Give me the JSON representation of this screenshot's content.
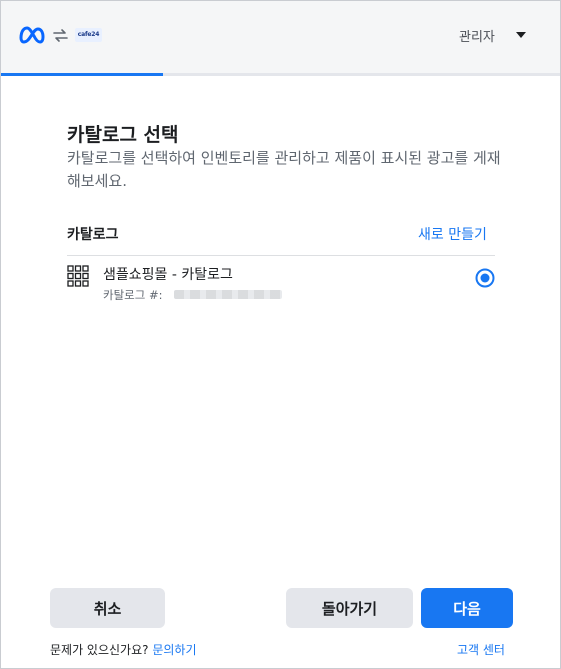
{
  "header": {
    "partner_logo_text": "cafe24",
    "admin_label": "관리자"
  },
  "progress": {
    "fraction": 0.29
  },
  "dialog": {
    "title": "카탈로그 선택",
    "subtitle": "카탈로그를 선택하여 인벤토리를 관리하고 제품이 표시된 광고를 게재해보세요."
  },
  "catalog_section": {
    "label": "카탈로그",
    "create_new": "새로 만들기",
    "items": [
      {
        "name": "샘플쇼핑몰 - 카탈로그",
        "id_label": "카탈로그 #:",
        "selected": true
      }
    ]
  },
  "footer": {
    "cancel": "취소",
    "back": "돌아가기",
    "next": "다음",
    "help_question": "문제가 있으신가요?",
    "help_link": "문의하기",
    "support_link": "고객 센터"
  },
  "colors": {
    "accent": "#1877f2",
    "button_secondary": "#e4e6eb",
    "header_bg": "#f5f6f7"
  },
  "icons": {
    "meta": "meta-logo-icon",
    "swap": "swap-arrows-icon",
    "dropdown": "caret-down-icon",
    "catalog": "grid-icon",
    "selection": "radio-selected-icon"
  }
}
